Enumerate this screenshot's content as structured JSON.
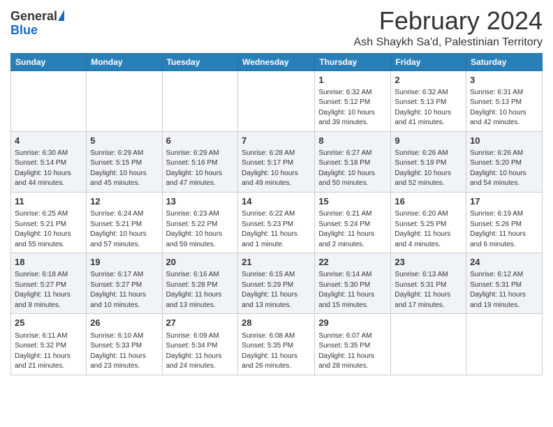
{
  "header": {
    "logo_general": "General",
    "logo_blue": "Blue",
    "month_title": "February 2024",
    "location": "Ash Shaykh Sa'd, Palestinian Territory"
  },
  "days_of_week": [
    "Sunday",
    "Monday",
    "Tuesday",
    "Wednesday",
    "Thursday",
    "Friday",
    "Saturday"
  ],
  "weeks": [
    [
      {
        "day": "",
        "info": ""
      },
      {
        "day": "",
        "info": ""
      },
      {
        "day": "",
        "info": ""
      },
      {
        "day": "",
        "info": ""
      },
      {
        "day": "1",
        "info": "Sunrise: 6:32 AM\nSunset: 5:12 PM\nDaylight: 10 hours\nand 39 minutes."
      },
      {
        "day": "2",
        "info": "Sunrise: 6:32 AM\nSunset: 5:13 PM\nDaylight: 10 hours\nand 41 minutes."
      },
      {
        "day": "3",
        "info": "Sunrise: 6:31 AM\nSunset: 5:13 PM\nDaylight: 10 hours\nand 42 minutes."
      }
    ],
    [
      {
        "day": "4",
        "info": "Sunrise: 6:30 AM\nSunset: 5:14 PM\nDaylight: 10 hours\nand 44 minutes."
      },
      {
        "day": "5",
        "info": "Sunrise: 6:29 AM\nSunset: 5:15 PM\nDaylight: 10 hours\nand 45 minutes."
      },
      {
        "day": "6",
        "info": "Sunrise: 6:29 AM\nSunset: 5:16 PM\nDaylight: 10 hours\nand 47 minutes."
      },
      {
        "day": "7",
        "info": "Sunrise: 6:28 AM\nSunset: 5:17 PM\nDaylight: 10 hours\nand 49 minutes."
      },
      {
        "day": "8",
        "info": "Sunrise: 6:27 AM\nSunset: 5:18 PM\nDaylight: 10 hours\nand 50 minutes."
      },
      {
        "day": "9",
        "info": "Sunrise: 6:26 AM\nSunset: 5:19 PM\nDaylight: 10 hours\nand 52 minutes."
      },
      {
        "day": "10",
        "info": "Sunrise: 6:26 AM\nSunset: 5:20 PM\nDaylight: 10 hours\nand 54 minutes."
      }
    ],
    [
      {
        "day": "11",
        "info": "Sunrise: 6:25 AM\nSunset: 5:21 PM\nDaylight: 10 hours\nand 55 minutes."
      },
      {
        "day": "12",
        "info": "Sunrise: 6:24 AM\nSunset: 5:21 PM\nDaylight: 10 hours\nand 57 minutes."
      },
      {
        "day": "13",
        "info": "Sunrise: 6:23 AM\nSunset: 5:22 PM\nDaylight: 10 hours\nand 59 minutes."
      },
      {
        "day": "14",
        "info": "Sunrise: 6:22 AM\nSunset: 5:23 PM\nDaylight: 11 hours\nand 1 minute."
      },
      {
        "day": "15",
        "info": "Sunrise: 6:21 AM\nSunset: 5:24 PM\nDaylight: 11 hours\nand 2 minutes."
      },
      {
        "day": "16",
        "info": "Sunrise: 6:20 AM\nSunset: 5:25 PM\nDaylight: 11 hours\nand 4 minutes."
      },
      {
        "day": "17",
        "info": "Sunrise: 6:19 AM\nSunset: 5:26 PM\nDaylight: 11 hours\nand 6 minutes."
      }
    ],
    [
      {
        "day": "18",
        "info": "Sunrise: 6:18 AM\nSunset: 5:27 PM\nDaylight: 11 hours\nand 8 minutes."
      },
      {
        "day": "19",
        "info": "Sunrise: 6:17 AM\nSunset: 5:27 PM\nDaylight: 11 hours\nand 10 minutes."
      },
      {
        "day": "20",
        "info": "Sunrise: 6:16 AM\nSunset: 5:28 PM\nDaylight: 11 hours\nand 13 minutes."
      },
      {
        "day": "21",
        "info": "Sunrise: 6:15 AM\nSunset: 5:29 PM\nDaylight: 11 hours\nand 13 minutes."
      },
      {
        "day": "22",
        "info": "Sunrise: 6:14 AM\nSunset: 5:30 PM\nDaylight: 11 hours\nand 15 minutes."
      },
      {
        "day": "23",
        "info": "Sunrise: 6:13 AM\nSunset: 5:31 PM\nDaylight: 11 hours\nand 17 minutes."
      },
      {
        "day": "24",
        "info": "Sunrise: 6:12 AM\nSunset: 5:31 PM\nDaylight: 11 hours\nand 19 minutes."
      }
    ],
    [
      {
        "day": "25",
        "info": "Sunrise: 6:11 AM\nSunset: 5:32 PM\nDaylight: 11 hours\nand 21 minutes."
      },
      {
        "day": "26",
        "info": "Sunrise: 6:10 AM\nSunset: 5:33 PM\nDaylight: 11 hours\nand 23 minutes."
      },
      {
        "day": "27",
        "info": "Sunrise: 6:09 AM\nSunset: 5:34 PM\nDaylight: 11 hours\nand 24 minutes."
      },
      {
        "day": "28",
        "info": "Sunrise: 6:08 AM\nSunset: 5:35 PM\nDaylight: 11 hours\nand 26 minutes."
      },
      {
        "day": "29",
        "info": "Sunrise: 6:07 AM\nSunset: 5:35 PM\nDaylight: 11 hours\nand 28 minutes."
      },
      {
        "day": "",
        "info": ""
      },
      {
        "day": "",
        "info": ""
      }
    ]
  ]
}
